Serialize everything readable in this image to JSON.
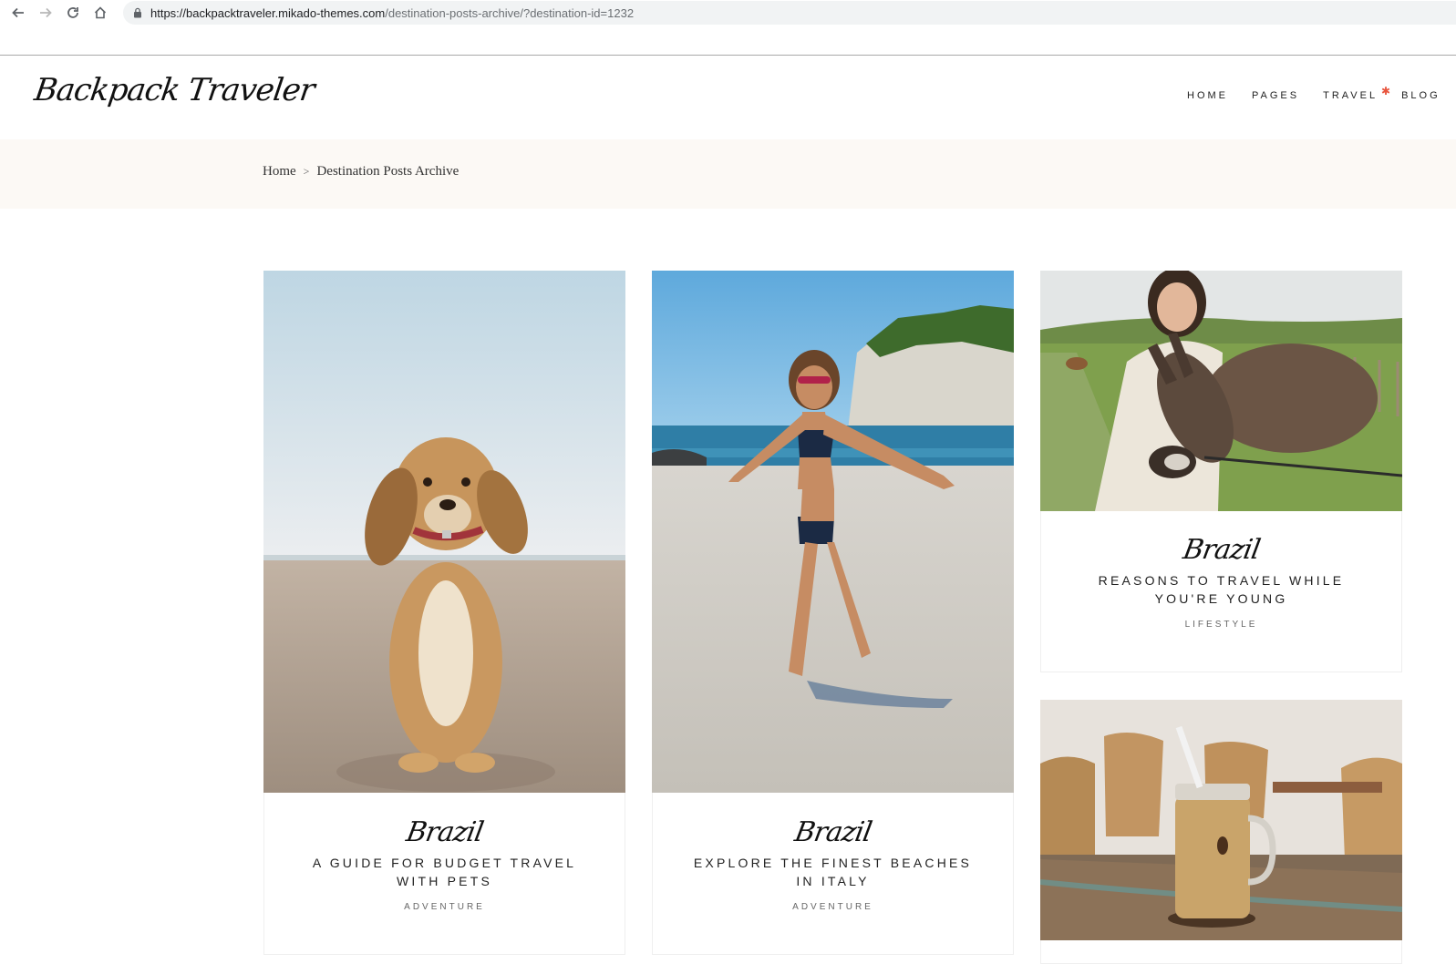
{
  "browser": {
    "url_host": "https://backpacktraveler.mikado-themes.com",
    "url_path": "/destination-posts-archive/?destination-id=1232"
  },
  "header": {
    "logo": "Backpack Traveler",
    "nav": [
      "HOME",
      "PAGES",
      "TRAVEL",
      "BLOG"
    ],
    "accent_color": "#e8553e"
  },
  "breadcrumb": {
    "home": "Home",
    "separator": ">",
    "current": "Destination Posts Archive"
  },
  "posts": [
    {
      "destination": "Brazil",
      "title": "A GUIDE FOR BUDGET TRAVEL WITH PETS",
      "category": "ADVENTURE",
      "image": "dog-on-beach"
    },
    {
      "destination": "Brazil",
      "title": "EXPLORE THE FINEST BEACHES IN ITALY",
      "category": "ADVENTURE",
      "image": "woman-on-beach"
    },
    {
      "destination": "Brazil",
      "title": "REASONS TO TRAVEL WHILE YOU'RE YOUNG",
      "category": "LIFESTYLE",
      "image": "woman-with-donkey"
    },
    {
      "image": "iced-coffee-jar"
    }
  ]
}
